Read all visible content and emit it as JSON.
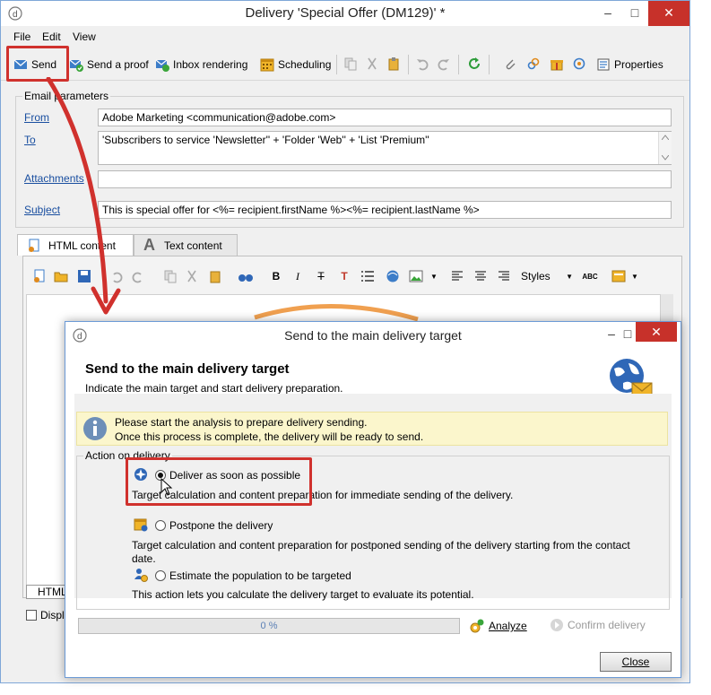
{
  "main_window": {
    "title": "Delivery 'Special Offer (DM129)' *",
    "controls": {
      "minimize": "–",
      "maximize": "□",
      "close": "✕"
    }
  },
  "menu": [
    "File",
    "Edit",
    "View"
  ],
  "toolbar": {
    "send": "Send",
    "send_proof": "Send a proof",
    "inbox_rendering": "Inbox rendering",
    "scheduling": "Scheduling",
    "properties": "Properties"
  },
  "email_params": {
    "legend": "Email parameters",
    "from_label": "From",
    "from_value": "Adobe Marketing <communication@adobe.com>",
    "to_label": "To",
    "to_value": "'Subscribers to service 'Newsletter'' + 'Folder 'Web'' + 'List 'Premium''",
    "attachments_label": "Attachments",
    "attachments_value": "",
    "subject_label": "Subject",
    "subject_value": "This is special offer for <%= recipient.firstName %><%= recipient.lastName %>"
  },
  "tabs": {
    "html": "HTML content",
    "text": "Text content",
    "bottom_tab": "HTML",
    "display_checkbox": "Displ"
  },
  "editor_toolbar": {
    "styles": "Styles"
  },
  "dialog": {
    "title": "Send to the main delivery target",
    "heading": "Send to the main delivery target",
    "subheading": "Indicate the main target and start delivery preparation.",
    "info_line1": "Please start the analysis to prepare delivery sending.",
    "info_line2": "Once this process is complete, the delivery will be ready to send.",
    "action_legend": "Action on delivery",
    "options": [
      {
        "label": "Deliver as soon as possible",
        "selected": true,
        "desc": "Target calculation and content preparation for immediate sending of the delivery."
      },
      {
        "label": "Postpone the delivery",
        "selected": false,
        "desc": "Target calculation and content preparation for postponed sending of the delivery starting from the contact date."
      },
      {
        "label": "Estimate the population to be targeted",
        "selected": false,
        "desc": "This action lets you calculate the delivery target to evaluate its potential."
      }
    ],
    "progress": "0 %",
    "progress_value": 0,
    "analyze": "Analyze",
    "confirm": "Confirm delivery",
    "close": "Close"
  },
  "colors": {
    "highlight": "#d0312d",
    "link": "#1a4fa0",
    "window_border": "#7fa7d8",
    "close_button": "#c7312a",
    "info_bar": "#fbf6cc"
  }
}
